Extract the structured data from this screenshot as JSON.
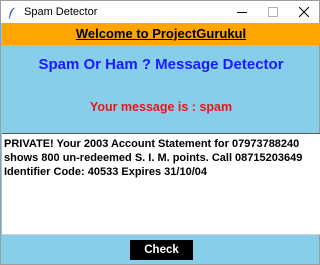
{
  "window": {
    "title": "Spam Detector"
  },
  "banner": {
    "text": "Welcome to ProjectGurukul",
    "color": "#ffa500"
  },
  "app": {
    "heading": "Spam Or Ham ? Message Detector",
    "result": "Your message is : spam",
    "background": "#87ceeb"
  },
  "message": {
    "value": "PRIVATE! Your 2003 Account Statement for 07973788240 shows 800 un-redeemed S. I. M. points. Call 08715203649 Identifier Code: 40533 Expires 31/10/04"
  },
  "actions": {
    "check_label": "Check"
  },
  "icons": {
    "app": "feather-icon",
    "minimize": "minimize-icon",
    "maximize": "maximize-icon",
    "close": "close-icon"
  }
}
